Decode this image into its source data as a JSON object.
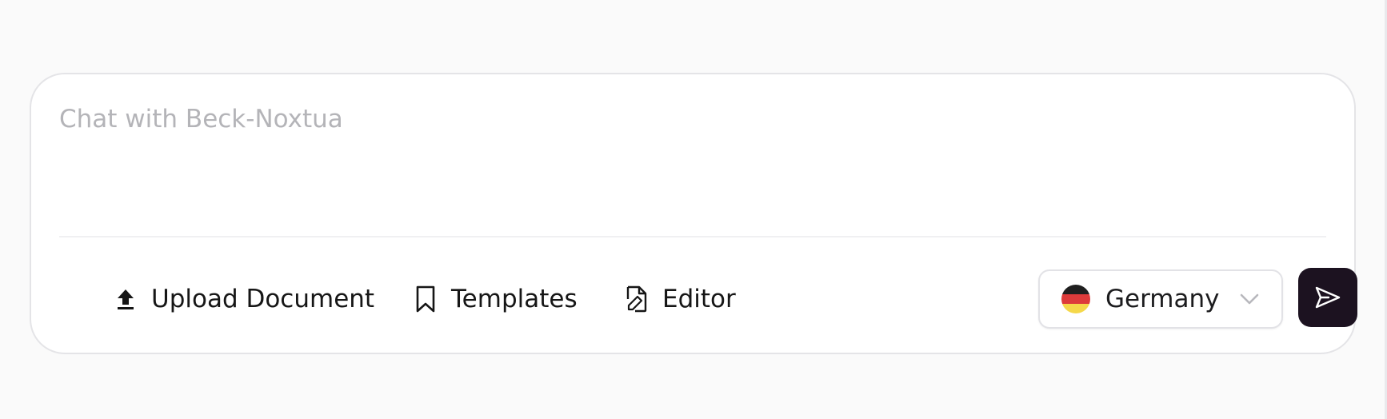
{
  "chat": {
    "placeholder": "Chat with Beck-Noxtua",
    "value": ""
  },
  "toolbar": {
    "upload_label": "Upload Document",
    "upload_icon": "upload-icon",
    "templates_label": "Templates",
    "templates_icon": "bookmark-icon",
    "editor_label": "Editor",
    "editor_icon": "file-edit-icon"
  },
  "country_select": {
    "selected": "Germany",
    "flag_icon": "germany-flag-icon",
    "flag_colors": [
      "#1f1f1f",
      "#dd3b3b",
      "#f5d84a"
    ],
    "chevron_icon": "chevron-down-icon"
  },
  "send": {
    "icon": "send-icon",
    "background": "#1c1220"
  }
}
